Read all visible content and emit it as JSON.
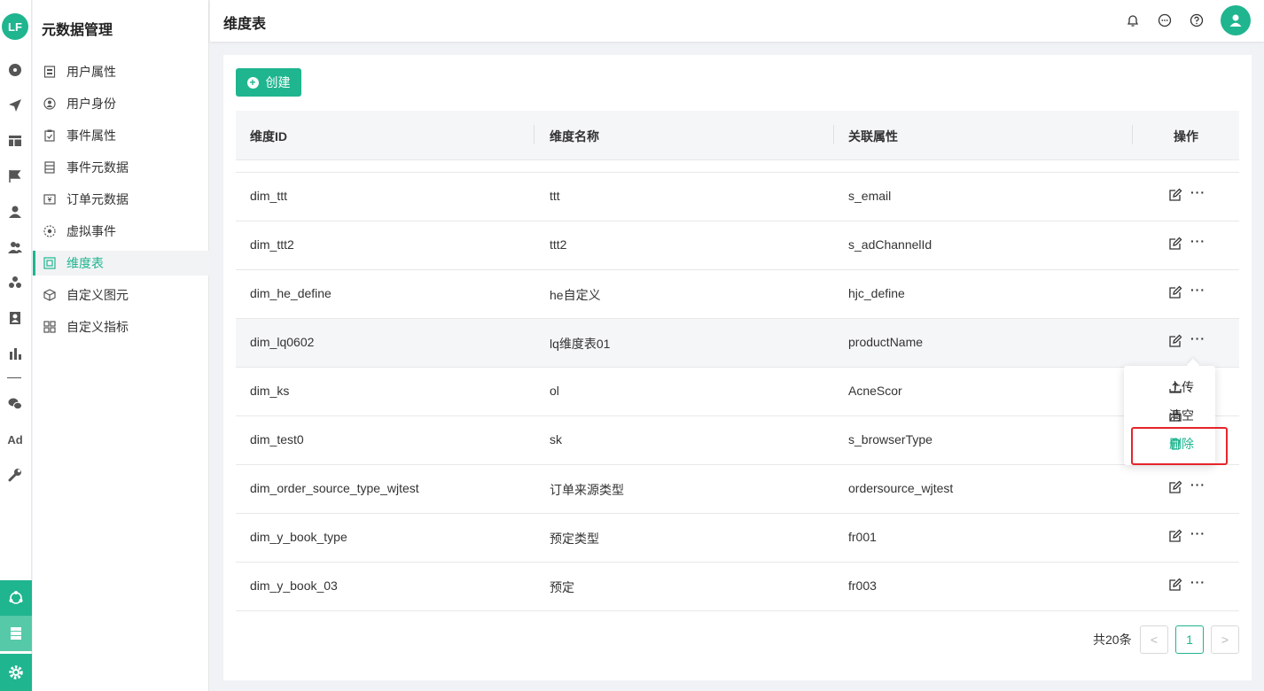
{
  "app": {
    "logo_text": "LF",
    "section_title": "元数据管理",
    "page_title": "维度表"
  },
  "sidebar": {
    "items": [
      {
        "label": "用户属性",
        "icon": "user-attribute-icon"
      },
      {
        "label": "用户身份",
        "icon": "user-identity-icon"
      },
      {
        "label": "事件属性",
        "icon": "event-attribute-icon"
      },
      {
        "label": "事件元数据",
        "icon": "event-metadata-icon"
      },
      {
        "label": "订单元数据",
        "icon": "order-metadata-icon"
      },
      {
        "label": "虚拟事件",
        "icon": "virtual-event-icon"
      },
      {
        "label": "维度表",
        "icon": "dimension-table-icon",
        "active": true
      },
      {
        "label": "自定义图元",
        "icon": "custom-primitive-icon"
      },
      {
        "label": "自定义指标",
        "icon": "custom-metric-icon"
      }
    ]
  },
  "rail_text": {
    "ad": "Ad"
  },
  "toolbar": {
    "create_label": "创建"
  },
  "table": {
    "headers": [
      "维度ID",
      "维度名称",
      "关联属性",
      "操作"
    ],
    "rows": [
      {
        "id": "dim_ttt",
        "name": "ttt",
        "attr": "s_email"
      },
      {
        "id": "dim_ttt2",
        "name": "ttt2",
        "attr": "s_adChannelId"
      },
      {
        "id": "dim_he_define",
        "name": "he自定义",
        "attr": "hjc_define"
      },
      {
        "id": "dim_lq0602",
        "name": "lq维度表01",
        "attr": "productName"
      },
      {
        "id": "dim_ks",
        "name": "ol",
        "attr": "AcneScor"
      },
      {
        "id": "dim_test0",
        "name": "sk",
        "attr": "s_browserType"
      },
      {
        "id": "dim_order_source_type_wjtest",
        "name": "订单来源类型",
        "attr": "ordersource_wjtest"
      },
      {
        "id": "dim_y_book_type",
        "name": "预定类型",
        "attr": "fr001"
      },
      {
        "id": "dim_y_book_03",
        "name": "预定",
        "attr": "fr003"
      }
    ],
    "more_glyph": "···"
  },
  "dropdown": {
    "upload": "上传",
    "clear": "清空",
    "delete": "删除"
  },
  "pagination": {
    "total": "共20条",
    "current": "1",
    "prev": "<",
    "next": ">"
  },
  "colors": {
    "brand": "#1fb58f",
    "highlight": "#e5252a"
  }
}
